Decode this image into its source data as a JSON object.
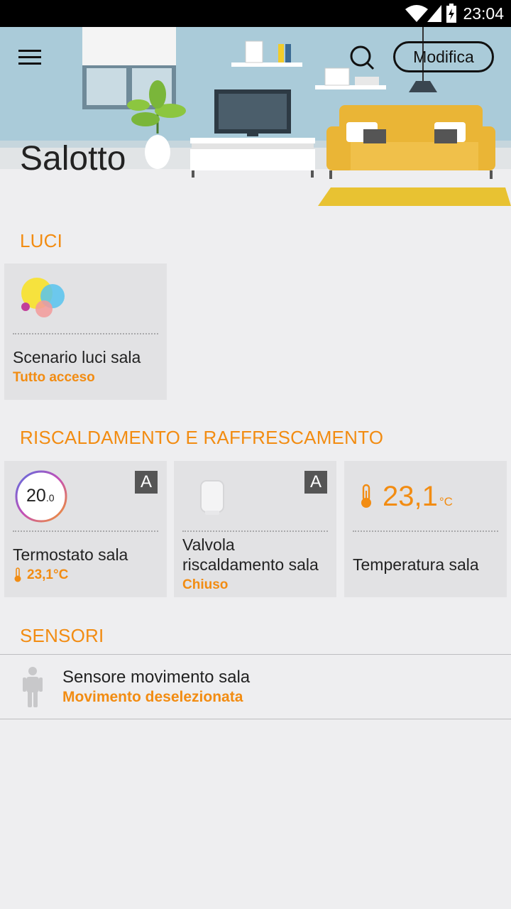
{
  "statusbar": {
    "time": "23:04"
  },
  "header": {
    "room_title": "Salotto",
    "edit_label": "Modifica"
  },
  "sections": {
    "lights": {
      "title": "LUCI",
      "cards": [
        {
          "name": "Scenario luci sala",
          "status": "Tutto acceso"
        }
      ]
    },
    "climate": {
      "title": "RISCALDAMENTO E RAFFRESCAMENTO",
      "thermostat": {
        "setpoint": "20",
        "setpoint_decimal": ".0",
        "badge": "A",
        "name": "Termostato sala",
        "status": "23,1°C"
      },
      "valve": {
        "badge": "A",
        "name_line1": "Valvola",
        "name_line2": "riscaldamento sala",
        "status": "Chiuso"
      },
      "temperature": {
        "value": "23,1",
        "unit": "°C",
        "name": "Temperatura sala"
      }
    },
    "sensors": {
      "title": "SENSORI",
      "items": [
        {
          "name": "Sensore movimento sala",
          "status": "Movimento deselezionata"
        }
      ]
    }
  },
  "colors": {
    "accent": "#f28c12",
    "card": "#e2e2e4",
    "background": "#eeeef0",
    "hero_wall": "#aacbd9",
    "sofa": "#eab536"
  },
  "icons": [
    "hamburger-menu-icon",
    "search-icon",
    "light-scenario-icon",
    "thermostat-dial-icon",
    "valve-icon",
    "thermometer-icon",
    "person-icon",
    "wifi-icon",
    "signal-icon",
    "battery-icon"
  ]
}
